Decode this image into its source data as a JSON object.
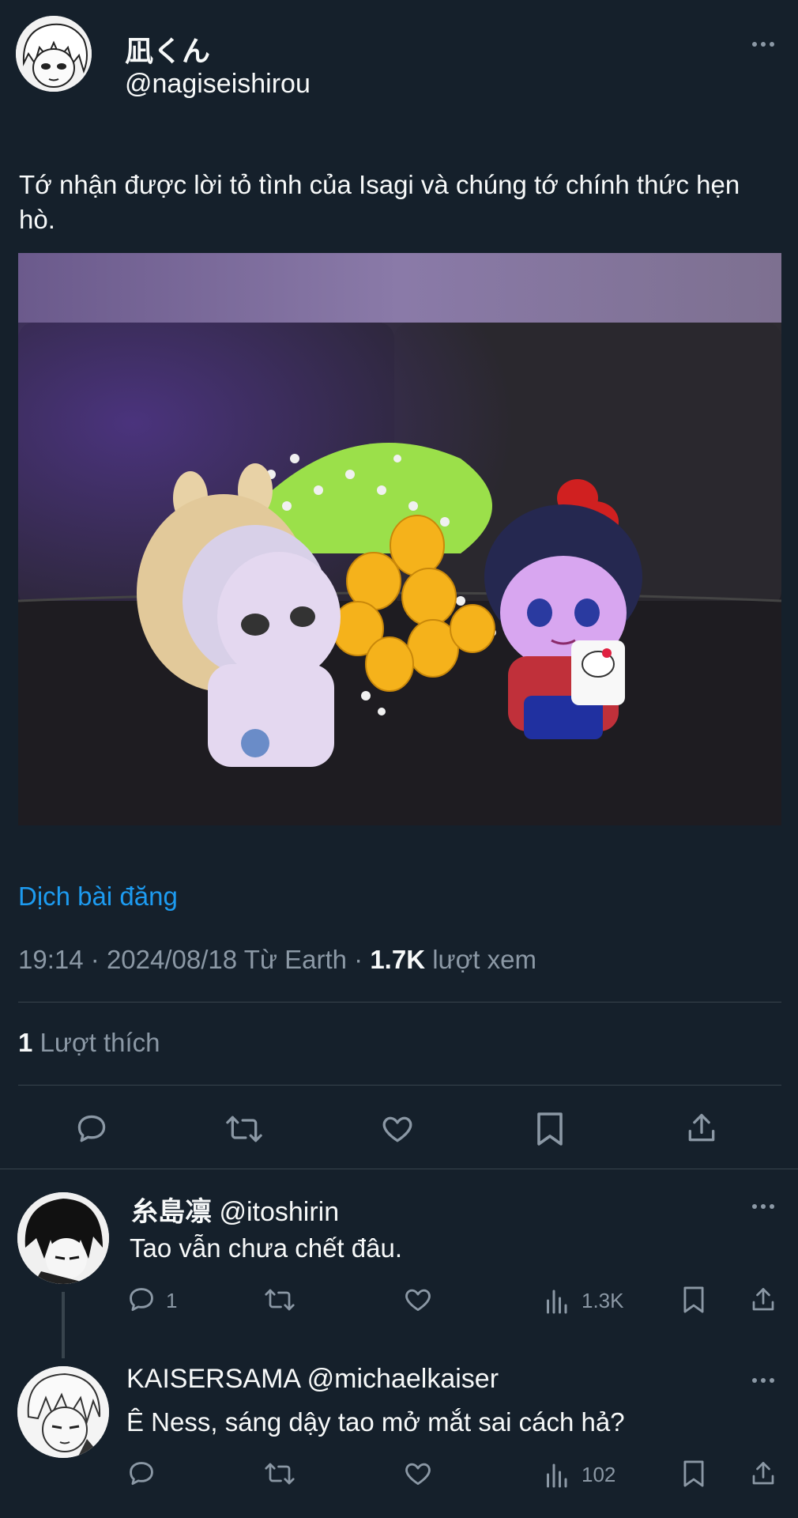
{
  "post": {
    "display_name": "凪くん",
    "handle": "@nagiseishirou",
    "text": "Tớ nhận được lời tỏ tình của Isagi và chúng tớ chính thức hẹn hò.",
    "translate_label": "Dịch bài đăng",
    "time": "19:14",
    "date": "2024/08/18",
    "location": "Từ Earth",
    "views_count": "1.7K",
    "views_label": "lượt xem",
    "likes_count": "1",
    "likes_label": "Lượt thích"
  },
  "replies": [
    {
      "display_name": "糸島凛",
      "handle": "@itoshirin",
      "text": "Tao vẫn chưa chết đâu.",
      "reply_count": "1",
      "views": "1.3K"
    },
    {
      "display_name": "KAISERSAMA",
      "handle": "@michaelkaiser",
      "text": "Ê Ness, sáng dậy tao mở mắt sai cách hả?",
      "reply_count": "",
      "views": "102"
    }
  ],
  "icons": {
    "reply": "speech-bubble",
    "retweet": "repost-arrows",
    "like": "heart",
    "bookmark": "bookmark",
    "share": "share-upload",
    "views": "bar-chart",
    "more": "three-dots"
  },
  "colors": {
    "background": "#15202b",
    "text": "#f7f9f9",
    "muted": "#8b98a5",
    "link": "#1d9bf0",
    "divider": "#38444d"
  }
}
